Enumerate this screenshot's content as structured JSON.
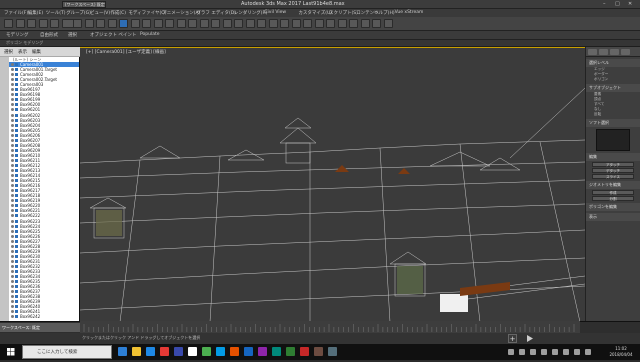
{
  "window": {
    "title": "Autodesk 3ds Max 2017     Last91b4e8.max",
    "tab": "(ワークスペース) 既定"
  },
  "menu": {
    "items": [
      "ファイル(F)",
      "編集(E)",
      "ツール(T)",
      "グループ(G)",
      "ビュー(V)",
      "作成(C)",
      "モディファイヤ(O)",
      "アニメーション(A)",
      "グラフ エディタ(D)",
      "レンダリング(R)",
      "Civil View",
      "カスタマイズ(U)",
      "スクリプト(S)",
      "コンテンツ",
      "ヘルプ(H)",
      "Vue xStream"
    ]
  },
  "ribbon": {
    "items": [
      "モデリング",
      "自由形式",
      "選択",
      "オブジェクト ペイント",
      "Populate"
    ],
    "sub": "ポリゴン モデリング"
  },
  "scene_explorer": {
    "tabs": [
      "選択",
      "表示",
      "編集"
    ],
    "root": "(ルート) シーン",
    "rows": [
      "Camera001",
      "Camera001.Target",
      "Camera002",
      "Camera002.Target",
      "Camera003",
      "Box96197",
      "Box96198",
      "Box96199",
      "Box96200",
      "Box96201",
      "Box96202",
      "Box96203",
      "Box96204",
      "Box96205",
      "Box96206",
      "Box96207",
      "Box96208",
      "Box96209",
      "Box96210",
      "Box96211",
      "Box96212",
      "Box96213",
      "Box96214",
      "Box96215",
      "Box96216",
      "Box96217",
      "Box96218",
      "Box96219",
      "Box96220",
      "Box96221",
      "Box96222",
      "Box96223",
      "Box96224",
      "Box96225",
      "Box96226",
      "Box96227",
      "Box96228",
      "Box96229",
      "Box96230",
      "Box96231",
      "Box96232",
      "Box96233",
      "Box96234",
      "Box96235",
      "Box96236",
      "Box96237",
      "Box96238",
      "Box96239",
      "Box96240",
      "Box96241",
      "Box96242"
    ],
    "selected_index": 0
  },
  "viewport": {
    "label": "[+] [Camera001] [ユーザ定義] [線画]"
  },
  "command_panel": {
    "sections": [
      "選択レベル",
      "サブオブジェクト",
      "ソフト選択",
      "編集",
      "ジオメトリを編集",
      "ポリゴンを編集",
      "表示"
    ],
    "items": [
      "エッジ",
      "ボーダー",
      "ポリゴン",
      "要素",
      "頂点",
      "すべて",
      "なし",
      "反転"
    ],
    "buttons": [
      "アタッチ",
      "デタッチ",
      "スライス",
      "作成",
      "分割"
    ]
  },
  "status": {
    "workspace": "ワークスペース: 既定",
    "prompt": "クリックまたはクリック アンド ドラッグしてオブジェクトを選択"
  },
  "taskbar": {
    "search_placeholder": "ここに入力して検索",
    "time": "11:02",
    "date": "2018/04/04",
    "icon_colors": [
      "#2d7fd6",
      "#f1c232",
      "#1e88e5",
      "#e53935",
      "#3949ab",
      "#ffffff",
      "#4caf50",
      "#039be5",
      "#e65100",
      "#1565c0",
      "#8e24aa",
      "#00897b",
      "#2e7d32",
      "#c62828",
      "#6d4c41",
      "#546e7a"
    ]
  }
}
